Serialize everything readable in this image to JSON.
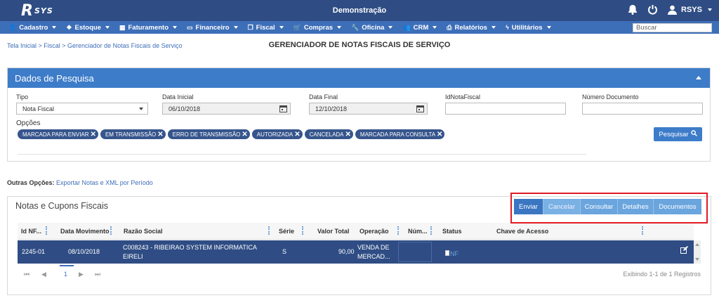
{
  "app": {
    "logo": "R",
    "logo_suffix": "SYS",
    "company": "Demonstração",
    "user": "RSYS"
  },
  "menu": [
    {
      "icon": "user-icon",
      "glyph": "👤",
      "label": "Cadastro"
    },
    {
      "icon": "cubes-icon",
      "glyph": "❖",
      "label": "Estoque"
    },
    {
      "icon": "calculator-icon",
      "glyph": "▦",
      "label": "Faturamento"
    },
    {
      "icon": "money-icon",
      "glyph": "▭",
      "label": "Financeiro"
    },
    {
      "icon": "file-icon",
      "glyph": "❐",
      "label": "Fiscal"
    },
    {
      "icon": "cart-icon",
      "glyph": "🛒",
      "label": "Compras"
    },
    {
      "icon": "wrench-icon",
      "glyph": "🔧",
      "label": "Oficina"
    },
    {
      "icon": "users-icon",
      "glyph": "👥",
      "label": "CRM"
    },
    {
      "icon": "print-icon",
      "glyph": "⎙",
      "label": "Relatórios"
    },
    {
      "icon": "bolt-icon",
      "glyph": "ϟ",
      "label": "Utilitários"
    }
  ],
  "search": {
    "placeholder": "Buscar"
  },
  "breadcrumb": "Tela Inicial > Fiscal > Gerenciador de Notas Fiscais de Serviço",
  "page_title": "GERENCIADOR DE NOTAS FISCAIS DE SERVIÇO",
  "filters": {
    "title": "Dados de Pesquisa",
    "tipo": {
      "label": "Tipo",
      "value": "Nota Fiscal"
    },
    "data_inicial": {
      "label": "Data Inicial",
      "value": "06/10/2018"
    },
    "data_final": {
      "label": "Data Final",
      "value": "12/10/2018"
    },
    "id_nota": {
      "label": "IdNotaFiscal",
      "value": ""
    },
    "numero_doc": {
      "label": "Número Documento",
      "value": ""
    },
    "opcoes_label": "Opções",
    "opcoes": [
      "MARCADA PARA ENVIAR",
      "EM TRANSMISSÃO",
      "ERRO DE TRANSMISSÃO",
      "AUTORIZADA",
      "CANCELADA",
      "MARCADA PARA CONSULTA"
    ],
    "search_button": "Pesquisar"
  },
  "outras": {
    "label": "Outras Opções:",
    "link": "Exportar Notas e XML por Período"
  },
  "grid": {
    "title": "Notas e Cupons Fiscais",
    "actions": [
      {
        "label": "Enviar",
        "color": "#3b76c2"
      },
      {
        "label": "Cancelar",
        "color": "#7ab1e4"
      },
      {
        "label": "Consultar",
        "color": "#6aa5de"
      },
      {
        "label": "Detalhes",
        "color": "#6aa5de"
      },
      {
        "label": "Documentos",
        "color": "#6aa5de"
      }
    ],
    "columns": [
      "Id NF...",
      "Data Movimento",
      "Razão Social",
      "Série",
      "Valor Total",
      "Operação",
      "Núm...",
      "Status",
      "Chave de Acesso"
    ],
    "rows": [
      {
        "id": "2245-01",
        "data": "08/10/2018",
        "razao1": "C008243 - RIBEIRAO SYSTEM INFORMATICA",
        "razao2": "EIRELI",
        "serie": "S",
        "valor": "90,00",
        "oper1": "VENDA DE",
        "oper2": "MERCAD...",
        "num": "",
        "status": "NF",
        "chave": ""
      }
    ],
    "pager": {
      "page": "1",
      "info": "Exibindo 1-1 de 1 Registros"
    }
  }
}
